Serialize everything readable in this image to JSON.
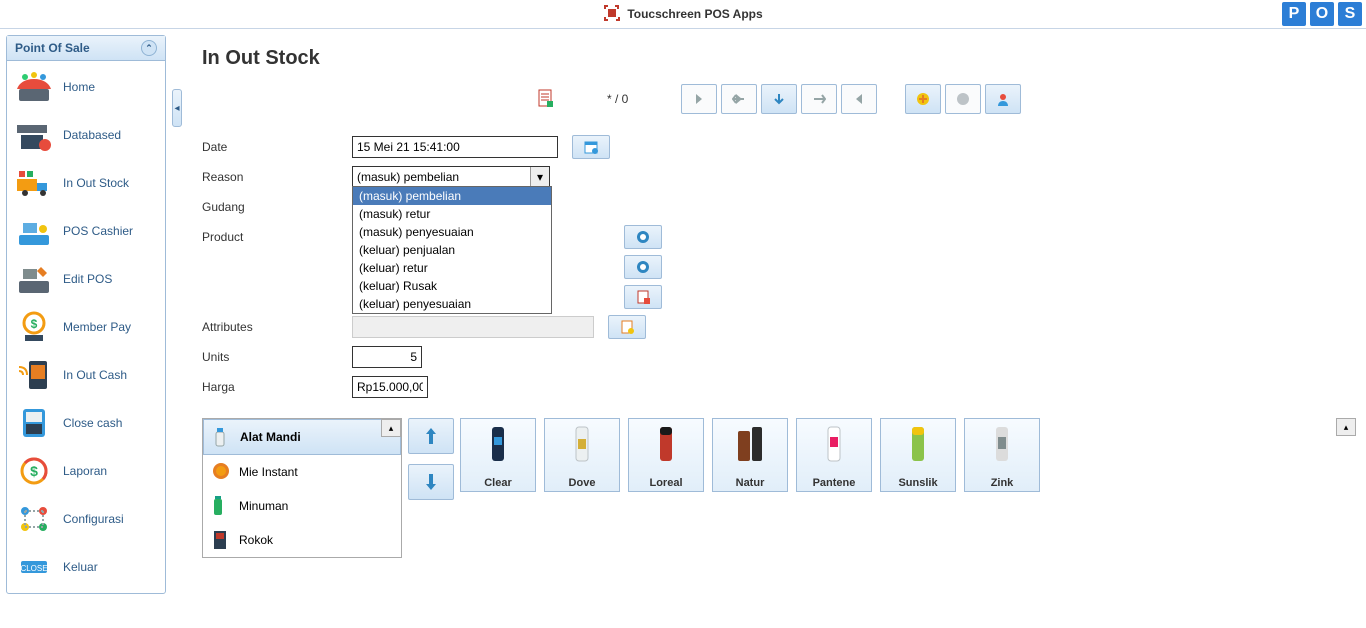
{
  "app": {
    "title": "Toucschreen POS Apps",
    "pos_letters": [
      "P",
      "O",
      "S"
    ]
  },
  "sidebar": {
    "header": "Point Of Sale",
    "items": [
      {
        "label": "Home"
      },
      {
        "label": "Databased"
      },
      {
        "label": "In Out Stock"
      },
      {
        "label": "POS Cashier"
      },
      {
        "label": "Edit POS"
      },
      {
        "label": "Member Pay"
      },
      {
        "label": "In Out Cash"
      },
      {
        "label": "Close cash"
      },
      {
        "label": "Laporan"
      },
      {
        "label": "Configurasi"
      },
      {
        "label": "Keluar"
      }
    ]
  },
  "page": {
    "title": "In Out Stock",
    "counter": "* / 0"
  },
  "form": {
    "date_label": "Date",
    "date_value": "15 Mei 21 15:41:00",
    "reason_label": "Reason",
    "reason_value": "(masuk) pembelian",
    "reason_options": [
      "(masuk) pembelian",
      "(masuk) retur",
      "(masuk) penyesuaian",
      "(keluar) penjualan",
      "(keluar) retur",
      "(keluar) Rusak",
      "(keluar) penyesuaian"
    ],
    "gudang_label": "Gudang",
    "product_label": "Product",
    "attributes_label": "Attributes",
    "units_label": "Units",
    "units_value": "5",
    "harga_label": "Harga",
    "harga_value": "Rp15.000,00"
  },
  "categories": [
    {
      "label": "Alat Mandi",
      "selected": true
    },
    {
      "label": "Mie Instant"
    },
    {
      "label": "Minuman"
    },
    {
      "label": "Rokok"
    }
  ],
  "products": [
    {
      "label": "Clear"
    },
    {
      "label": "Dove"
    },
    {
      "label": "Loreal"
    },
    {
      "label": "Natur"
    },
    {
      "label": "Pantene"
    },
    {
      "label": "Sunslik"
    },
    {
      "label": "Zink"
    }
  ]
}
